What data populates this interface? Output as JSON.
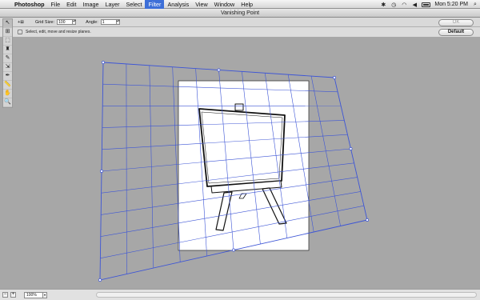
{
  "menubar": {
    "app_name": "Photoshop",
    "items": [
      "File",
      "Edit",
      "Image",
      "Layer",
      "Select",
      "Filter",
      "Analysis",
      "View",
      "Window",
      "Help"
    ],
    "active_item": "Filter",
    "clock": "Mon 5:20 PM"
  },
  "dialog": {
    "title": "Vanishing Point"
  },
  "options_bar": {
    "grid_size_label": "Grid Size:",
    "grid_size_value": "100",
    "angle_label": "Angle:",
    "angle_value": "1",
    "ok_label": "OK",
    "default_label": "Default"
  },
  "hint": {
    "text": "Select, edit, move and resize planes."
  },
  "tools": [
    {
      "name": "edit-plane-tool-icon",
      "glyph": "↖"
    },
    {
      "name": "create-plane-tool-icon",
      "glyph": "⊞"
    },
    {
      "name": "marquee-tool-icon",
      "glyph": "⬚"
    },
    {
      "name": "stamp-tool-icon",
      "glyph": "♜"
    },
    {
      "name": "brush-tool-icon",
      "glyph": "✎"
    },
    {
      "name": "transform-tool-icon",
      "glyph": "⇲"
    },
    {
      "name": "eyedropper-tool-icon",
      "glyph": "✒"
    },
    {
      "name": "measure-tool-icon",
      "glyph": "📏"
    },
    {
      "name": "hand-tool-icon",
      "glyph": "✋"
    },
    {
      "name": "zoom-tool-icon",
      "glyph": "🔍"
    }
  ],
  "status": {
    "zoom_value": "100%"
  },
  "colors": {
    "grid_line": "#3d55d6",
    "menu_highlight": "#3d6fd8",
    "canvas_bg": "#a7a7a7"
  }
}
